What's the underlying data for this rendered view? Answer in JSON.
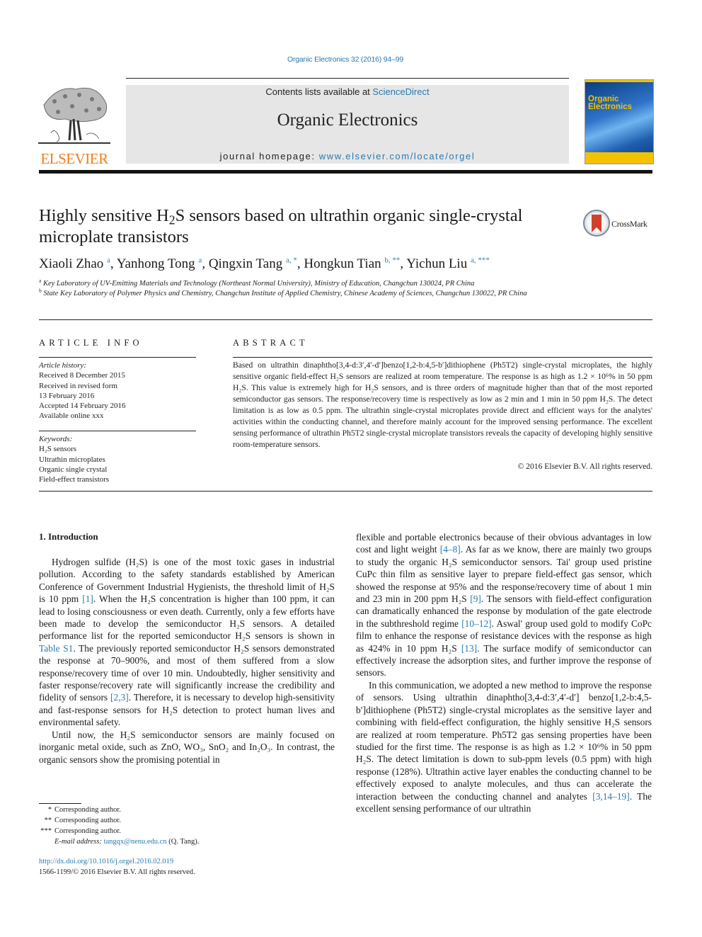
{
  "header": {
    "journal_reference": "Organic Electronics 32 (2016) 94–99",
    "contents_prefix": "Contents lists available at ",
    "contents_link": "ScienceDirect",
    "journal_title": "Organic Electronics",
    "homepage_prefix": "journal homepage: ",
    "homepage_link": "www.elsevier.com/locate/orgel",
    "publisher_wordmark": "ELSEVIER",
    "cover_title_line1": "Organic",
    "cover_title_line2": "Electronics",
    "crossmark_label": "CrossMark",
    "colors": {
      "link": "#2a7ab0",
      "elsevier_orange": "#f07d1a",
      "masthead_bg": "#e6e6e6",
      "cover_yellow": "#f2c200",
      "cover_blue": "#2f73c8"
    }
  },
  "article": {
    "title_part1": "Highly sensitive H",
    "title_sub": "2",
    "title_part2": "S sensors based on ultrathin organic single-crystal microplate transistors",
    "authors": [
      {
        "name": "Xiaoli Zhao",
        "marks": "a"
      },
      {
        "name": "Yanhong Tong",
        "marks": "a"
      },
      {
        "name": "Qingxin Tang",
        "marks": "a, *"
      },
      {
        "name": "Hongkun Tian",
        "marks": "b, **"
      },
      {
        "name": "Yichun Liu",
        "marks": "a, ***"
      }
    ],
    "affiliations": [
      {
        "mark": "a",
        "text": "Key Laboratory of UV-Emitting Materials and Technology (Northeast Normal University), Ministry of Education, Changchun 130024, PR China"
      },
      {
        "mark": "b",
        "text": "State Key Laboratory of Polymer Physics and Chemistry, Changchun Institute of Applied Chemistry, Chinese Academy of Sciences, Changchun 130022, PR China"
      }
    ]
  },
  "article_info": {
    "heading": "ARTICLE INFO",
    "history_label": "Article history:",
    "history": [
      "Received 8 December 2015",
      "Received in revised form",
      "13 February 2016",
      "Accepted 14 February 2016",
      "Available online xxx"
    ],
    "keywords_label": "Keywords:",
    "keywords": [
      "H₂S sensors",
      "Ultrathin microplates",
      "Organic single crystal",
      "Field-effect transistors"
    ]
  },
  "abstract": {
    "heading": "ABSTRACT",
    "text": "Based on ultrathin dinaphtho[3,4-d:3′,4′-d′]benzo[1,2-b:4,5-b′]dithiophene (Ph5T2) single-crystal microplates, the highly sensitive organic field-effect H₂S sensors are realized at room temperature. The response is as high as 1.2 × 10⁶% in 50 ppm H₂S. This value is extremely high for H₂S sensors, and is three orders of magnitude higher than that of the most reported semiconductor gas sensors. The response/recovery time is respectively as low as 2 min and 1 min in 50 ppm H₂S. The detect limitation is as low as 0.5 ppm. The ultrathin single-crystal microplates provide direct and efficient ways for the analytes' activities within the conducting channel, and therefore mainly account for the improved sensing performance. The excellent sensing performance of ultrathin Ph5T2 single-crystal microplate transistors reveals the capacity of developing highly sensitive room-temperature sensors.",
    "copyright": "© 2016 Elsevier B.V. All rights reserved."
  },
  "introduction": {
    "heading": "1.  Introduction",
    "left_p1": [
      {
        "t": "Hydrogen sulfide (H₂S) is one of the most toxic gases in industrial pollution. According to the safety standards established by American Conference of Government Industrial Hygienists, the threshold limit of H₂S is 10 ppm "
      },
      {
        "ref": "[1]"
      },
      {
        "t": ". When the H₂S concentration is higher than 100 ppm, it can lead to losing consciousness or even death. Currently, only a few efforts have been made to develop the semiconductor H₂S sensors. A detailed performance list for the reported semiconductor H₂S sensors is shown in "
      },
      {
        "ref": "Table S1"
      },
      {
        "t": ". The previously reported semiconductor H₂S sensors demonstrated the response at 70–900%, and most of them suffered from a slow response/recovery time of over 10 min. Undoubtedly, higher sensitivity and faster response/recovery rate will significantly increase the credibility and fidelity of sensors "
      },
      {
        "ref": "[2,3]"
      },
      {
        "t": ". Therefore, it is necessary to develop high-sensitivity and fast-response sensors for H₂S detection to protect human lives and environmental safety."
      }
    ],
    "left_p2": [
      {
        "t": "Until now, the H₂S semiconductor sensors are mainly focused on inorganic metal oxide, such as ZnO, WO₃, SnO₂ and In₂O₃. In contrast, the organic sensors show the promising potential in"
      }
    ],
    "right_p1": [
      {
        "t": "flexible and portable electronics because of their obvious advantages in low cost and light weight "
      },
      {
        "ref": "[4–8]"
      },
      {
        "t": ". As far as we know, there are mainly two groups to study the organic H₂S semiconductor sensors. Tai' group used pristine CuPc thin film as sensitive layer to prepare field-effect gas sensor, which showed the response at 95% and the response/recovery time of about 1 min and 23 min in 200 ppm H₂S "
      },
      {
        "ref": "[9]"
      },
      {
        "t": ". The sensors with field-effect configuration can dramatically enhanced the response by modulation of the gate electrode in the subthreshold regime "
      },
      {
        "ref": "[10–12]"
      },
      {
        "t": ". Aswal' group used gold to modify CoPc film to enhance the response of resistance devices with the response as high as 424% in 10 ppm H₂S "
      },
      {
        "ref": "[13]"
      },
      {
        "t": ". The surface modify of semiconductor can effectively increase the adsorption sites, and further improve the response of sensors."
      }
    ],
    "right_p2": [
      {
        "t": "In this communication, we adopted a new method to improve the response of sensors. Using ultrathin dinaphtho[3,4-d:3′,4′-d′] benzo[1,2-b:4,5-b′]dithiophene (Ph5T2) single-crystal microplates as the sensitive layer and combining with field-effect configuration, the highly sensitive H₂S sensors are realized at room temperature. Ph5T2 gas sensing properties have been studied for the first time. The response is as high as 1.2 × 10⁶% in 50 ppm H₂S. The detect limitation is down to sub-ppm levels (0.5 ppm) with high response (128%). Ultrathin active layer enables the conducting channel to be effectively exposed to analyte molecules, and thus can accelerate the interaction between the conducting channel and analytes "
      },
      {
        "ref": "[3,14–19]"
      },
      {
        "t": ". The excellent sensing performance of our ultrathin"
      }
    ]
  },
  "footnotes": {
    "items": [
      {
        "mark": "*",
        "text": "Corresponding author."
      },
      {
        "mark": "**",
        "text": "Corresponding author."
      },
      {
        "mark": "***",
        "text": "Corresponding author."
      }
    ],
    "email_label": "E-mail address: ",
    "email": "tangqx@nenu.edu.cn",
    "email_owner": " (Q. Tang).",
    "doi": "http://dx.doi.org/10.1016/j.orgel.2016.02.019",
    "issn": "1566-1199/© 2016 Elsevier B.V. All rights reserved."
  }
}
